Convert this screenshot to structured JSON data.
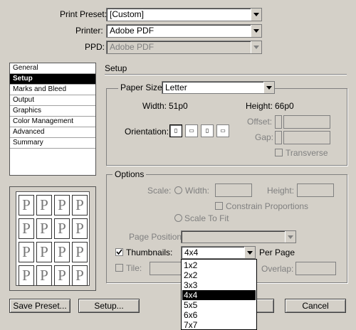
{
  "top": {
    "print_preset_label": "Print Preset:",
    "print_preset_value": "[Custom]",
    "printer_label": "Printer:",
    "printer_value": "Adobe PDF",
    "ppd_label": "PPD:",
    "ppd_value": "Adobe PDF"
  },
  "sidebar": {
    "items": [
      {
        "label": "General"
      },
      {
        "label": "Setup"
      },
      {
        "label": "Marks and Bleed"
      },
      {
        "label": "Output"
      },
      {
        "label": "Graphics"
      },
      {
        "label": "Color Management"
      },
      {
        "label": "Advanced"
      },
      {
        "label": "Summary"
      }
    ],
    "selected": "Setup"
  },
  "preview": {
    "letter": "P",
    "grid": "4x4"
  },
  "setup": {
    "section_title": "Setup",
    "paper_size_label": "Paper Size:",
    "paper_size_value": "Letter",
    "width_label": "Width:",
    "width_value": "51p0",
    "height_label": "Height:",
    "height_value": "66p0",
    "offset_label": "Offset:",
    "gap_label": "Gap:",
    "orientation_label": "Orientation:",
    "transverse_label": "Transverse",
    "orientation_icons": [
      "portrait-icon",
      "landscape-icon",
      "reverse-portrait-icon",
      "reverse-landscape-icon"
    ]
  },
  "options": {
    "group_label": "Options",
    "scale_label": "Scale:",
    "scale_width_label": "Width:",
    "scale_height_label": "Height:",
    "constrain_label": "Constrain Proportions",
    "scale_to_fit_label": "Scale To Fit",
    "page_position_label": "Page Position:",
    "thumbnails_label": "Thumbnails:",
    "thumbnails_checked": true,
    "thumbnails_value": "4x4",
    "per_page_label": "Per Page",
    "tile_label": "Tile:",
    "overlap_label": "Overlap:",
    "thumbnail_options": [
      "1x2",
      "2x2",
      "3x3",
      "4x4",
      "5x5",
      "6x6",
      "7x7"
    ],
    "thumbnail_selected": "4x4"
  },
  "buttons": {
    "save_preset": "Save Preset...",
    "setup": "Setup...",
    "cancel": "Cancel"
  }
}
